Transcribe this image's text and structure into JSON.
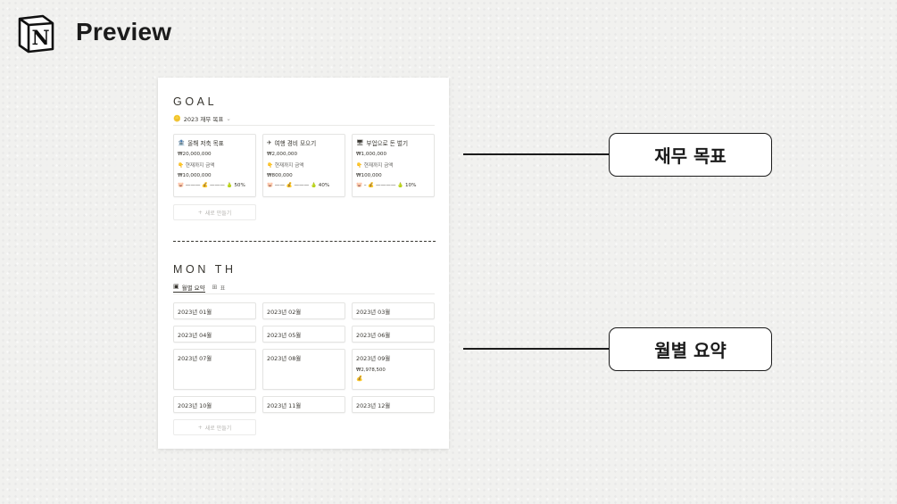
{
  "header": {
    "title": "Preview",
    "logo_letter": "N"
  },
  "goal": {
    "section_title": "GOAL",
    "view_tab": "2023 재무 목표",
    "view_tab_icon": "coins-icon",
    "cards": [
      {
        "icon": "🏦",
        "title": "올해 저축 목표",
        "target": "₩20,000,000",
        "current_label": "👇 현재까지 금액",
        "current": "₩10,000,000",
        "progress_text": "🐷 ——— 💰 ——— 🍐 50%",
        "progress": 0.5
      },
      {
        "icon": "✈",
        "title": "여행 경비 모으기",
        "target": "₩2,000,000",
        "current_label": "👇 현재까지 금액",
        "current": "₩800,000",
        "progress_text": "🐷 —— 💰 ——— 🍐 40%",
        "progress": 0.4
      },
      {
        "icon": "🖥",
        "title": "부업으로 돈 벌기",
        "target": "₩1,000,000",
        "current_label": "👇 현재까지 금액",
        "current": "₩100,000",
        "progress_text": "🐷 – 💰 ———— 🍐 10%",
        "progress": 0.1
      }
    ],
    "new_label": "새로 만들기"
  },
  "month": {
    "section_title": "MON TH",
    "tabs": [
      {
        "icon": "calendar-icon",
        "label": "월별 요약"
      },
      {
        "icon": "table-icon",
        "label": "표"
      }
    ],
    "cards": [
      {
        "title": "2023년 01월"
      },
      {
        "title": "2023년 02월"
      },
      {
        "title": "2023년 03월"
      },
      {
        "title": "2023년 04월"
      },
      {
        "title": "2023년 05월"
      },
      {
        "title": "2023년 06월"
      },
      {
        "title": "2023년 07월"
      },
      {
        "title": "2023년 08월"
      },
      {
        "title": "2023년 09월",
        "amount": "₩2,978,500",
        "emoji": "💰"
      },
      {
        "title": "2023년 10월"
      },
      {
        "title": "2023년 11월"
      },
      {
        "title": "2023년 12월"
      }
    ],
    "new_label": "새로 만들기"
  },
  "callouts": [
    {
      "label": "재무 목표"
    },
    {
      "label": "월별 요약"
    }
  ],
  "colors": {
    "text": "#37352f",
    "callout_border": "#1b1b1b",
    "page_bg": "#ffffff",
    "background": "#f1f1ef"
  }
}
